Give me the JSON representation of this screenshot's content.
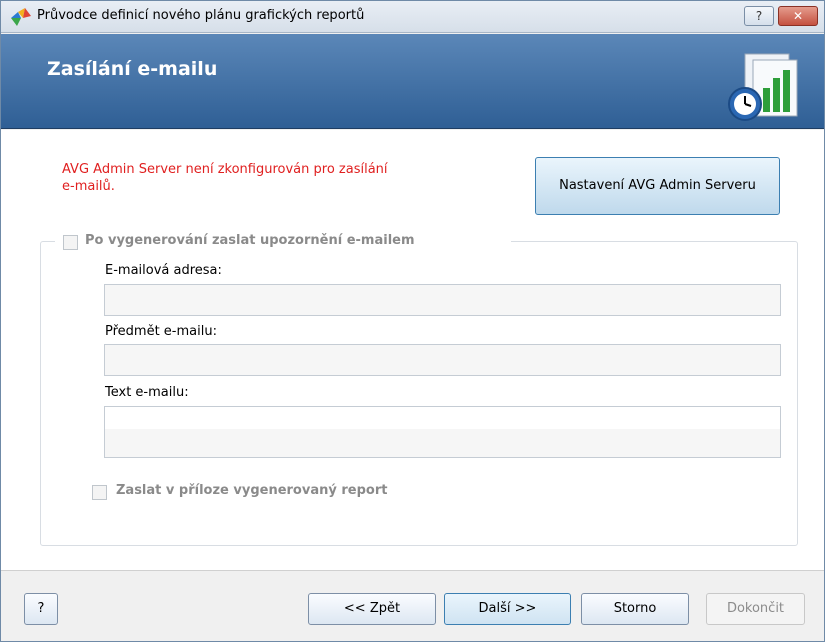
{
  "window": {
    "title": "Průvodce definicí nového plánu grafických reportů",
    "help_button": "?",
    "close_button": "✕"
  },
  "header": {
    "title": "Zasílání e-mailu"
  },
  "warning": {
    "line1": "AVG Admin Server není zkonfigurován pro zasílání",
    "line2": "e-mailů."
  },
  "config_button": "Nastavení AVG Admin Serveru",
  "group": {
    "checkbox_label": "Po vygenerování zaslat upozornění e-mailem",
    "checked": false,
    "email_label": "E-mailová adresa:",
    "email_value": "",
    "subject_label": "Předmět e-mailu:",
    "subject_value": "",
    "body_label": "Text e-mailu:",
    "body_value": "",
    "attach_label": "Zaslat v příloze vygenerovaný report",
    "attach_checked": false
  },
  "footer": {
    "help": "?",
    "back": "<< Zpět",
    "next": "Další >>",
    "cancel": "Storno",
    "finish": "Dokončit"
  },
  "colors": {
    "banner": "#3b6ca4",
    "warning": "#e02020",
    "disabled_text": "#8a8a8a"
  }
}
